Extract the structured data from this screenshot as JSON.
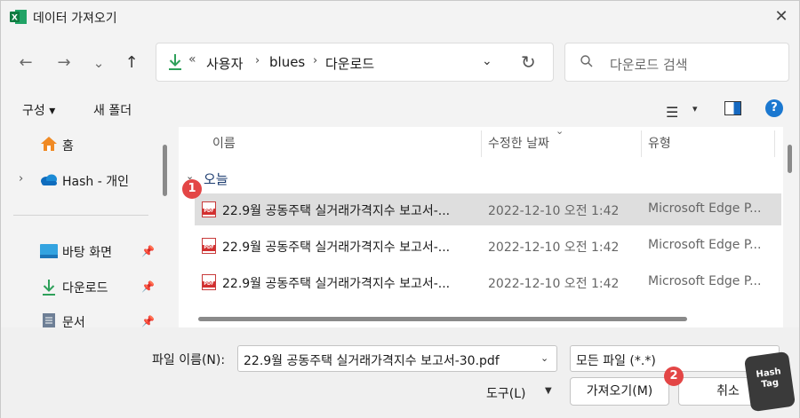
{
  "window": {
    "title": "데이터 가져오기",
    "close_glyph": "✕"
  },
  "nav": {
    "back_glyph": "←",
    "forward_glyph": "→",
    "recent_glyph": "⌄",
    "up_glyph": "↑"
  },
  "address": {
    "overflow": "«",
    "crumbs": [
      "사용자",
      "blues",
      "다운로드"
    ],
    "separator": "›",
    "dropdown_glyph": "⌄",
    "refresh_glyph": "↻"
  },
  "search": {
    "placeholder": "다운로드 검색"
  },
  "commandbar": {
    "organize": "구성 ▾",
    "new_folder": "새 폴더",
    "view_glyph": "☰",
    "view_dd": "▾",
    "help": "?"
  },
  "sidebar": {
    "items": [
      {
        "label": "홈"
      },
      {
        "label": "Hash - 개인",
        "expand": "›"
      },
      {
        "label": "바탕 화면",
        "pin": "📌"
      },
      {
        "label": "다운로드",
        "pin": "📌"
      },
      {
        "label": "문서",
        "pin": "📌"
      }
    ]
  },
  "columns": {
    "name": "이름",
    "modified": "수정한 날짜",
    "type": "유형",
    "sort_glyph": "⌄"
  },
  "group": {
    "chevron": "⌄",
    "label": "오늘"
  },
  "files": [
    {
      "icon": "PDF",
      "name": "22.9월 공동주택 실거래가격지수 보고서-...",
      "date": "2022-12-10 오전 1:42",
      "type": "Microsoft Edge P..."
    },
    {
      "icon": "PDF",
      "name": "22.9월 공동주택 실거래가격지수 보고서-...",
      "date": "2022-12-10 오전 1:42",
      "type": "Microsoft Edge P..."
    },
    {
      "icon": "PDF",
      "name": "22.9월 공동주택 실거래가격지수 보고서-...",
      "date": "2022-12-10 오전 1:42",
      "type": "Microsoft Edge P..."
    }
  ],
  "footer": {
    "filename_label": "파일 이름(N):",
    "filename_value": "22.9월 공동주택 실거래가격지수 보고서-30.pdf",
    "filetype_value": "모든 파일 (*.*)",
    "dropdown_glyph": "⌄",
    "tools": "도구(L)",
    "tools_dd": "▼",
    "import": "가져오기(M)",
    "cancel": "취소"
  },
  "annotations": {
    "badge1": "1",
    "badge2": "2"
  },
  "watermark": {
    "line1": "Hash",
    "line2": "Tag"
  },
  "colors": {
    "accent": "#1b78d0",
    "selection": "#dedede",
    "badge": "#e34646",
    "pdf_red": "#d32f2f",
    "download_green": "#2ea05a"
  }
}
